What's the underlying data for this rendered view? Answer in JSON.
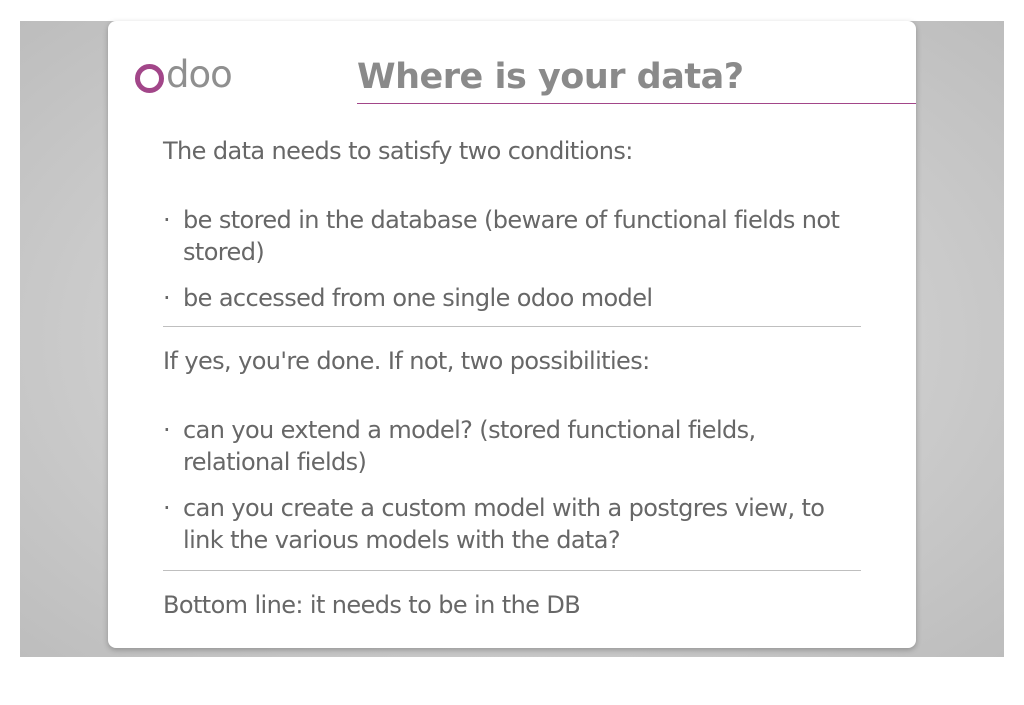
{
  "slide": {
    "logo_text": "doo",
    "title": "Where is your data?",
    "sections": {
      "conditions": {
        "intro": "The data needs to satisfy two conditions:",
        "bullets": [
          "be stored in the database (beware of functional fields not stored)",
          "be accessed from one single odoo model"
        ]
      },
      "alternatives": {
        "intro": "If yes, you're done. If not, two possibilities:",
        "bullets": [
          "can you extend a model? (stored functional fields, relational fields)",
          "can you create a custom model with a postgres view, to link the various models with the data?"
        ]
      },
      "conclusion": {
        "text": "Bottom line: it needs to be in the DB"
      }
    }
  },
  "colors": {
    "brand_purple": "#a24689",
    "text_gray": "#676767",
    "title_gray": "#8a8a8a",
    "backdrop_gray": "#c8c8c8"
  },
  "icons": {
    "logo": "odoo-logo-icon"
  }
}
